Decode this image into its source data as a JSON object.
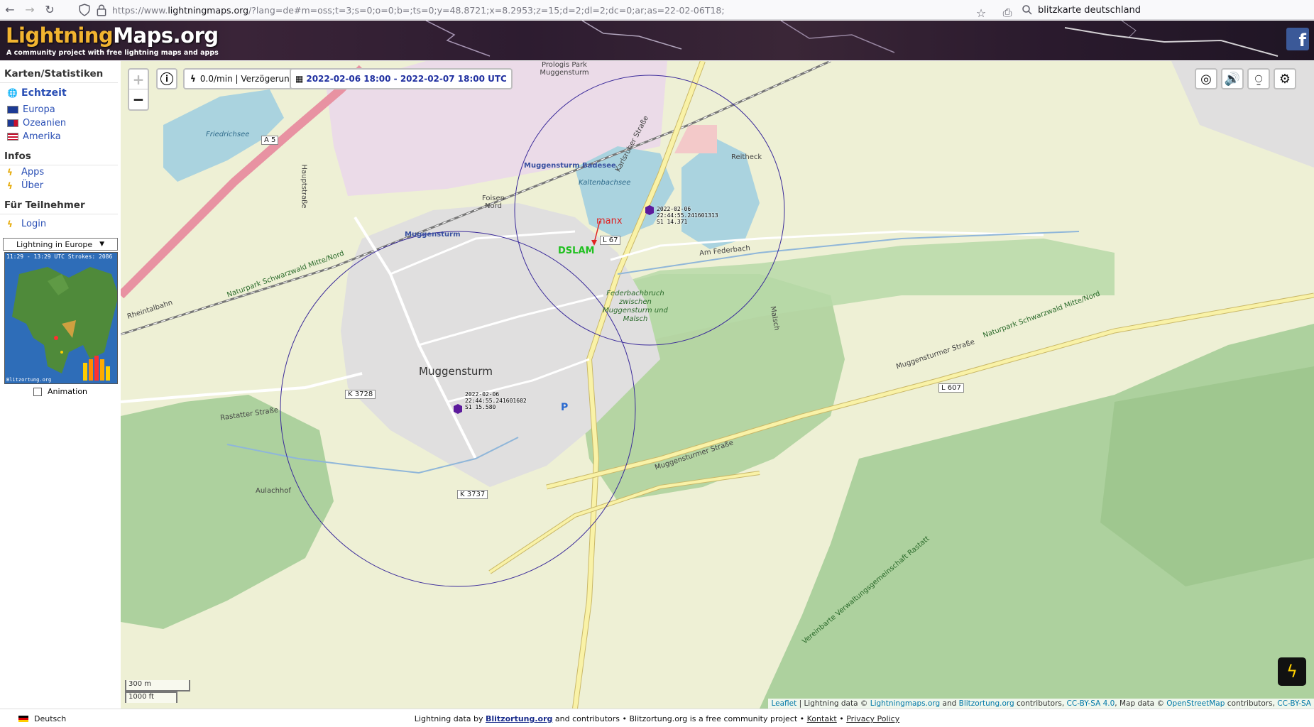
{
  "browser": {
    "url_prefix": "https://www.",
    "url_domain": "lightningmaps.org",
    "url_rest": "/?lang=de#m=oss;t=3;s=0;o=0;b=;ts=0;y=48.8721;x=8.2953;z=15;d=2;dl=2;dc=0;ar;as=22-02-06T18;",
    "search_text": "blitzkarte deutschland"
  },
  "header": {
    "logo_part1": "Lightning",
    "logo_part2": "Maps.org",
    "tagline": "A community project with free lightning maps and apps",
    "fb_letter": "f"
  },
  "sidebar": {
    "section1": "Karten/Statistiken",
    "realtime": "Echtzeit",
    "regions": [
      "Europa",
      "Ozeanien",
      "Amerika"
    ],
    "section2": "Infos",
    "infos": [
      "Apps",
      "Über"
    ],
    "section3": "Für Teilnehmer",
    "login": "Login",
    "select_value": "Lightning in Europe",
    "mini_map_text": "11:29 - 13:29 UTC Strokes: 2086",
    "mini_map_footer": "Blitzortung.org",
    "animation_label": "Animation"
  },
  "map": {
    "rate": "0.0/min | Verzögerung: ?",
    "date_range": "2022-02-06 18:00 - 2022-02-07 18:00 UTC",
    "zoom_in": "+",
    "zoom_out": "−",
    "info": "i",
    "scale_m": "300 m",
    "scale_ft": "1000 ft",
    "places": {
      "muggensturm": "Muggensturm",
      "muggensturm_station": "Muggensturm",
      "badesee": "Muggensturm Badesee",
      "prologis": "Prologis Park Muggensturm",
      "reitheck": "Reitheck",
      "aulachhof": "Aulachhof",
      "federbachbruch": "Federbachbruch zwischen Muggensturm und Malsch",
      "kaltenbachsee": "Kaltenbachsee",
      "friedrichsee": "Friedrichsee",
      "foisen_nord": "Foisen Nord"
    },
    "roads": {
      "a5": "A 5",
      "l67": "L 67",
      "l607": "L 607",
      "k3728": "K 3728",
      "k3737": "K 3737",
      "karlsruher": "Karlsruher Straße",
      "muggensturmer1": "Muggensturmer Straße",
      "muggensturmer2": "Muggensturmer Straße",
      "rastatter": "Rastatter Straße",
      "naturpark1": "Naturpark Schwarzwald Mitte/Nord",
      "naturpark2": "Naturpark Schwarzwald Mitte/Nord",
      "am_federbach": "Am Federbach",
      "hauptstrasse": "Hauptstraße",
      "rheintalbahn": "Rheintalbahn",
      "malsch": "Malsch",
      "vereinbarte": "Vereinbarte Verwaltungsgemeinschaft Rastatt"
    },
    "markers": {
      "manx": "manx",
      "dslam": "DSLAM",
      "parking": "P"
    },
    "strikes": [
      {
        "line1": "2022-02-06",
        "line2": "22:44:55.241601313",
        "line3": "S1 14.371"
      },
      {
        "line1": "2022-02-06",
        "line2": "22:44:55.241601602",
        "line3": "S1 15.580"
      }
    ],
    "attribution": {
      "leaflet": "Leaflet",
      "t1": " | Lightning data © ",
      "lm": "Lightningmaps.org",
      "t2": " and ",
      "bo": "Blitzortung.org",
      "t3": " contributors, ",
      "cc1": "CC-BY-SA 4.0",
      "t4": ", Map data © ",
      "osm": "OpenStreetMap",
      "t5": " contributors, ",
      "cc2": "CC-BY-SA"
    }
  },
  "footer": {
    "language": "Deutsch",
    "text1": "Lightning data by ",
    "link1": "Blitzortung.org",
    "text2": " and contributors • Blitzortung.org is a free community project • ",
    "link2": "Kontakt",
    "sep": " • ",
    "link3": "Privacy Policy"
  },
  "colors": {
    "forest": "#add19e",
    "wetland": "#b7d9a8",
    "water": "#aad3df",
    "residential": "#e0dfdf",
    "industrial": "#ebdbe8",
    "motorway": "#e892a2",
    "primary": "#f9f2a7",
    "strike_marker": "#5c1a9c",
    "range_circle": "#3a2a9a"
  }
}
